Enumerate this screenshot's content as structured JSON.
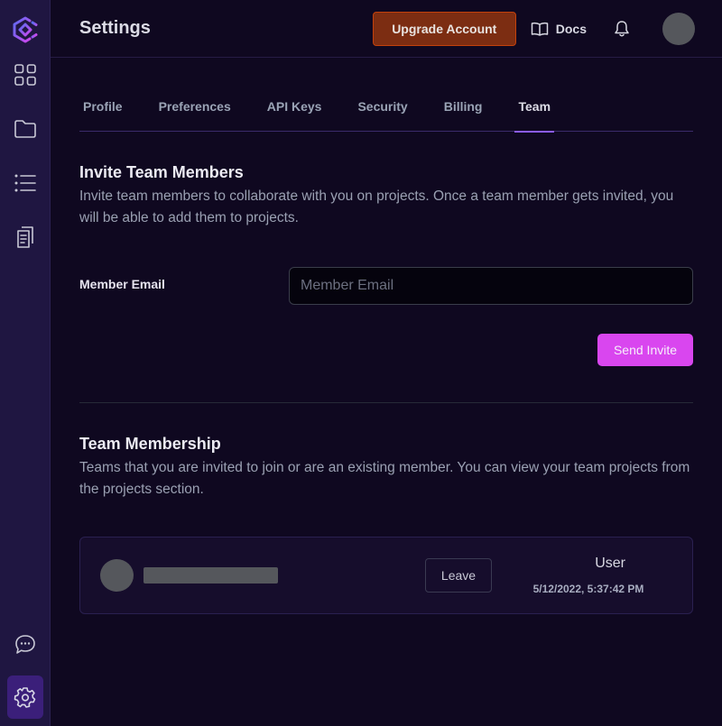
{
  "sidebar": {
    "logo": "app-logo",
    "items": [
      {
        "name": "dashboard",
        "icon": "grid-icon"
      },
      {
        "name": "projects",
        "icon": "folder-icon"
      },
      {
        "name": "list",
        "icon": "list-icon"
      },
      {
        "name": "documents",
        "icon": "documents-icon"
      }
    ],
    "bottom": [
      {
        "name": "chat",
        "icon": "chat-icon"
      },
      {
        "name": "settings",
        "icon": "gear-icon",
        "active": true
      }
    ]
  },
  "header": {
    "title": "Settings",
    "upgrade_label": "Upgrade Account",
    "docs_label": "Docs",
    "accent_upgrade": "#7c2d12"
  },
  "tabs": [
    {
      "label": "Profile",
      "active": false
    },
    {
      "label": "Preferences",
      "active": false
    },
    {
      "label": "API Keys",
      "active": false
    },
    {
      "label": "Security",
      "active": false
    },
    {
      "label": "Billing",
      "active": false
    },
    {
      "label": "Team",
      "active": true
    }
  ],
  "invite": {
    "title": "Invite Team Members",
    "description": "Invite team members to collaborate with you on projects. Once a team member gets invited, you will be able to add them to projects.",
    "email_label": "Member Email",
    "email_value": "",
    "email_placeholder": "Member Email",
    "send_label": "Send Invite",
    "accent": "#d946ef"
  },
  "membership": {
    "title": "Team Membership",
    "description": "Teams that you are invited to join or are an existing member. You can view your team projects from the projects section.",
    "members": [
      {
        "name": "",
        "leave_label": "Leave",
        "role": "User",
        "date": "5/12/2022, 5:37:42 PM"
      }
    ]
  }
}
